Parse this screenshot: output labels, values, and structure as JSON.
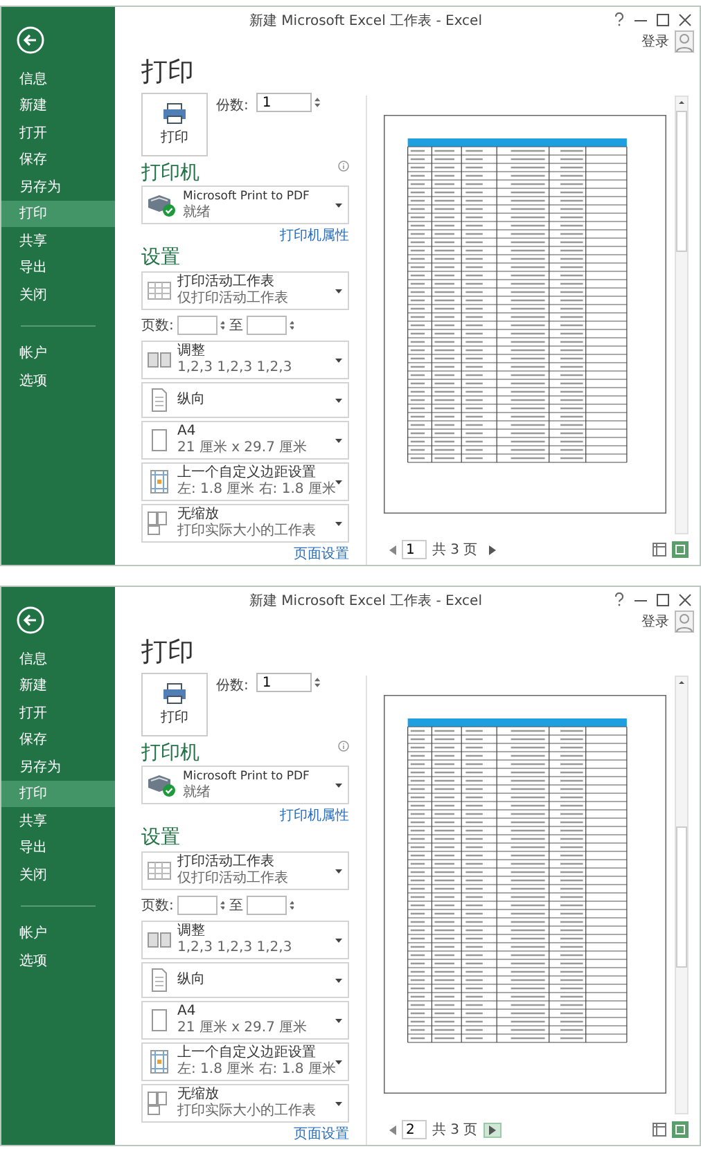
{
  "screens": [
    {
      "title": "新建 Microsoft Excel 工作表 - Excel",
      "sign_in": "登录",
      "nav": [
        {
          "label": "信息",
          "selected": false
        },
        {
          "label": "新建",
          "selected": false
        },
        {
          "label": "打开",
          "selected": false
        },
        {
          "label": "保存",
          "selected": false
        },
        {
          "label": "另存为",
          "selected": false
        },
        {
          "label": "打印",
          "selected": true
        },
        {
          "label": "共享",
          "selected": false
        },
        {
          "label": "导出",
          "selected": false
        },
        {
          "label": "关闭",
          "selected": false
        }
      ],
      "account_nav": [
        {
          "label": "帐户",
          "selected": false
        },
        {
          "label": "选项",
          "selected": false
        }
      ],
      "heading": "打印",
      "print_button": "打印",
      "copies_label": "份数:",
      "copies": "1",
      "printer_heading": "打印机",
      "printer": {
        "name": "Microsoft Print to PDF",
        "status": "就绪"
      },
      "printer_properties": "打印机属性",
      "settings_heading": "设置",
      "settings": [
        {
          "kind": "sheets",
          "title": "打印活动工作表",
          "subtitle": "仅打印活动工作表"
        },
        {
          "kind": "pages",
          "from_label": "页数:",
          "to_label": "至"
        },
        {
          "kind": "collate",
          "title": "调整",
          "subtitle": "1,2,3 1,2,3 1,2,3"
        },
        {
          "kind": "orientation",
          "title": "纵向"
        },
        {
          "kind": "paper",
          "title": "A4",
          "subtitle": "21 厘米 x 29.7 厘米"
        },
        {
          "kind": "margins",
          "title": "上一个自定义边距设置",
          "subtitle": "左: 1.8 厘米 右: 1.8 厘米"
        },
        {
          "kind": "scaling",
          "title": "无缩放",
          "subtitle": "打印实际大小的工作表"
        }
      ],
      "page_setup": "页面设置",
      "page_number": "1",
      "page_total": "共 3 页",
      "next_highlighted": false
    },
    {
      "title": "新建 Microsoft Excel 工作表 - Excel",
      "sign_in": "登录",
      "nav": [
        {
          "label": "信息",
          "selected": false
        },
        {
          "label": "新建",
          "selected": false
        },
        {
          "label": "打开",
          "selected": false
        },
        {
          "label": "保存",
          "selected": false
        },
        {
          "label": "另存为",
          "selected": false
        },
        {
          "label": "打印",
          "selected": true
        },
        {
          "label": "共享",
          "selected": false
        },
        {
          "label": "导出",
          "selected": false
        },
        {
          "label": "关闭",
          "selected": false
        }
      ],
      "account_nav": [
        {
          "label": "帐户",
          "selected": false
        },
        {
          "label": "选项",
          "selected": false
        }
      ],
      "heading": "打印",
      "print_button": "打印",
      "copies_label": "份数:",
      "copies": "1",
      "printer_heading": "打印机",
      "printer": {
        "name": "Microsoft Print to PDF",
        "status": "就绪"
      },
      "printer_properties": "打印机属性",
      "settings_heading": "设置",
      "settings": [
        {
          "kind": "sheets",
          "title": "打印活动工作表",
          "subtitle": "仅打印活动工作表"
        },
        {
          "kind": "pages",
          "from_label": "页数:",
          "to_label": "至"
        },
        {
          "kind": "collate",
          "title": "调整",
          "subtitle": "1,2,3 1,2,3 1,2,3"
        },
        {
          "kind": "orientation",
          "title": "纵向"
        },
        {
          "kind": "paper",
          "title": "A4",
          "subtitle": "21 厘米 x 29.7 厘米"
        },
        {
          "kind": "margins",
          "title": "上一个自定义边距设置",
          "subtitle": "左: 1.8 厘米 右: 1.8 厘米"
        },
        {
          "kind": "scaling",
          "title": "无缩放",
          "subtitle": "打印实际大小的工作表"
        }
      ],
      "page_setup": "页面设置",
      "page_number": "2",
      "page_total": "共 3 页",
      "next_highlighted": true
    }
  ]
}
